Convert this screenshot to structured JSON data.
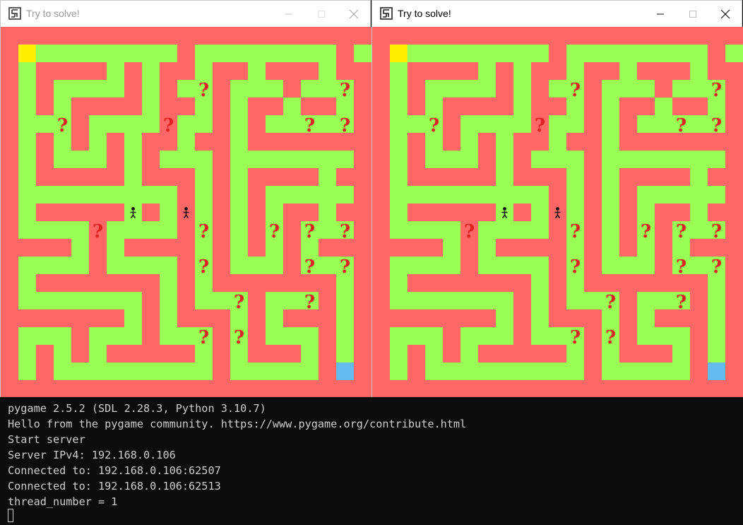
{
  "windows": [
    {
      "id": "left",
      "title": "Try to solve!",
      "state": "inactive"
    },
    {
      "id": "right",
      "title": "Try to solve!",
      "state": "active"
    }
  ],
  "maze": {
    "colors": {
      "wall": "#ff6666",
      "path": "#99ff55",
      "start": "#ffee00",
      "goal": "#66bbee",
      "question": "#dd2222",
      "player": "#111111"
    },
    "question_mark": "?",
    "question_cells": [
      [
        11,
        3
      ],
      [
        19,
        3
      ],
      [
        3,
        5
      ],
      [
        9,
        5
      ],
      [
        17,
        5
      ],
      [
        19,
        5
      ],
      [
        5,
        11
      ],
      [
        11,
        11
      ],
      [
        15,
        11
      ],
      [
        17,
        11
      ],
      [
        19,
        11
      ],
      [
        11,
        13
      ],
      [
        17,
        13
      ],
      [
        19,
        13
      ],
      [
        13,
        15
      ],
      [
        17,
        15
      ],
      [
        11,
        17
      ],
      [
        13,
        17
      ]
    ],
    "players_left": [
      [
        7,
        10
      ],
      [
        10,
        10
      ]
    ],
    "players_right": [
      [
        7,
        10
      ],
      [
        10,
        10
      ]
    ]
  },
  "console": {
    "lines": [
      "pygame 2.5.2 (SDL 2.28.3, Python 3.10.7)",
      "Hello from the pygame community. https://www.pygame.org/contribute.html",
      "Start server",
      "Server IPv4: 192.168.0.106",
      "Connected to: 192.168.0.106:62507",
      "Connected to: 192.168.0.106:62513",
      "thread_number = 1"
    ]
  }
}
